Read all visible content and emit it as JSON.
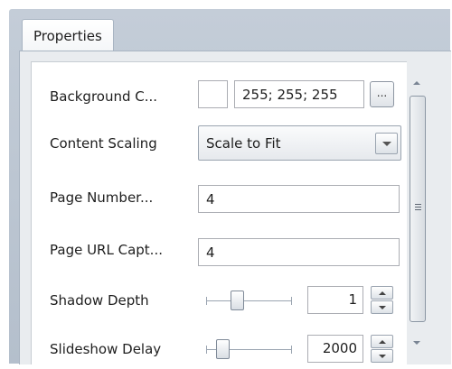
{
  "panel": {
    "tab_label": "Properties"
  },
  "properties": {
    "background_color": {
      "label": "Background C...",
      "value": "255; 255; 255",
      "swatch_color": "#ffffff",
      "browse_label": "..."
    },
    "content_scaling": {
      "label": "Content Scaling",
      "value": "Scale to Fit"
    },
    "page_number": {
      "label": "Page Number...",
      "value": "4"
    },
    "page_url_caption": {
      "label": "Page URL Capt...",
      "value": "4"
    },
    "shadow_depth": {
      "label": "Shadow Depth",
      "value": "1"
    },
    "slideshow_delay": {
      "label": "Slideshow Delay",
      "value": "2000"
    }
  }
}
